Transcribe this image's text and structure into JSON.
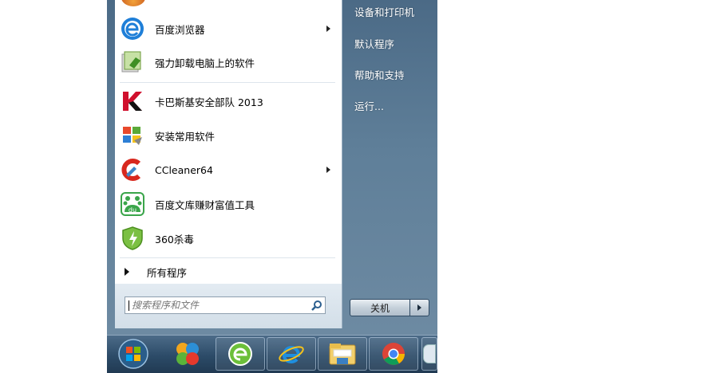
{
  "start_menu": {
    "programs": [
      {
        "label": "百度浏览器",
        "icon": "baidu-browser-icon",
        "has_submenu": true
      },
      {
        "label": "强力卸载电脑上的软件",
        "icon": "uninstaller-icon",
        "has_submenu": false
      },
      {
        "label": "卡巴斯基安全部队 2013",
        "icon": "kaspersky-icon",
        "has_submenu": false
      },
      {
        "label": "安装常用软件",
        "icon": "windows-installer-icon",
        "has_submenu": false
      },
      {
        "label": "CCleaner64",
        "icon": "ccleaner-icon",
        "has_submenu": true
      },
      {
        "label": "百度文库赚财富值工具",
        "icon": "baidu-wenku-icon",
        "has_submenu": false
      },
      {
        "label": "360杀毒",
        "icon": "360-antivirus-icon",
        "has_submenu": false
      }
    ],
    "all_programs_label": "所有程序",
    "search": {
      "placeholder": "搜索程序和文件"
    },
    "right_links": [
      "设备和打印机",
      "默认程序",
      "帮助和支持",
      "运行..."
    ],
    "shutdown_label": "关机"
  },
  "taskbar": {
    "items": [
      "start-orb-icon",
      "media-app-icon",
      "360-browser-icon",
      "internet-explorer-icon",
      "file-explorer-icon",
      "chrome-icon",
      "partial-app-icon"
    ]
  },
  "colors": {
    "start_menu_right": "#5f7f99",
    "taskbar": "#2c4b68",
    "left_pane": "#ffffff"
  }
}
